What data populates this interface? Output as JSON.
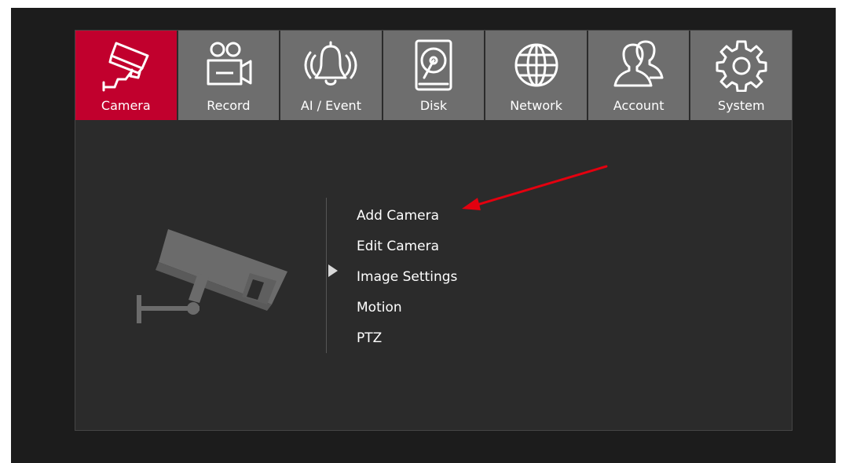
{
  "tabs": [
    {
      "label": "Camera",
      "icon": "camera-icon",
      "active": true
    },
    {
      "label": "Record",
      "icon": "record-icon",
      "active": false
    },
    {
      "label": "AI / Event",
      "icon": "ai-event-bell-icon",
      "active": false
    },
    {
      "label": "Disk",
      "icon": "disk-icon",
      "active": false
    },
    {
      "label": "Network",
      "icon": "network-globe-icon",
      "active": false
    },
    {
      "label": "Account",
      "icon": "account-users-icon",
      "active": false
    },
    {
      "label": "System",
      "icon": "system-gear-icon",
      "active": false
    }
  ],
  "menu": {
    "items": [
      {
        "label": "Add Camera"
      },
      {
        "label": "Edit Camera"
      },
      {
        "label": "Image Settings"
      },
      {
        "label": "Motion"
      },
      {
        "label": "PTZ"
      }
    ]
  },
  "colors": {
    "active_tab": "#c1002d",
    "inactive_tab": "#6e6e6e",
    "panel_bg": "#2b2b2b",
    "screen_bg": "#1c1c1c",
    "annotation_arrow": "#e3000f"
  }
}
